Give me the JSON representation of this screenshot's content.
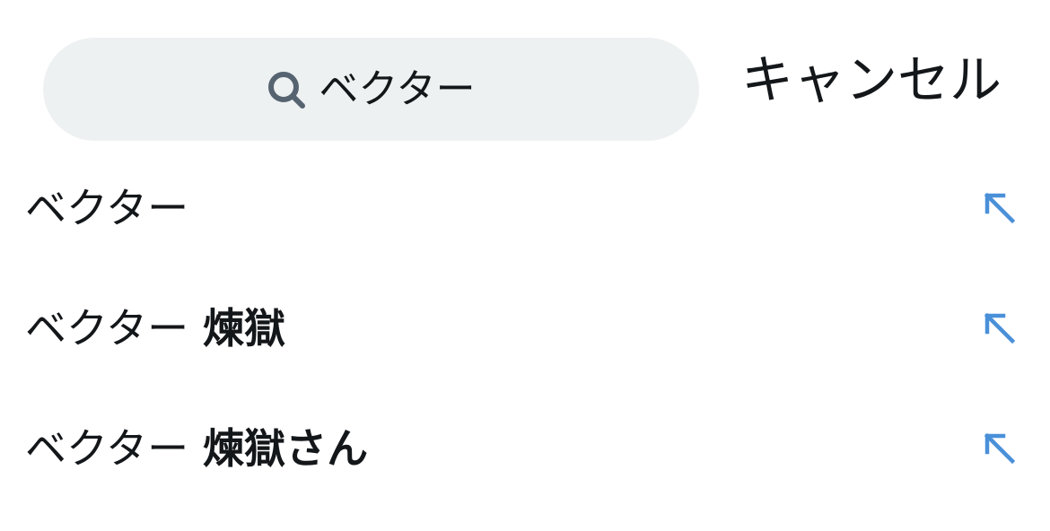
{
  "search": {
    "value": "ベクター",
    "icon": "search-icon",
    "cancel_label": "キャンセル"
  },
  "suggestions": [
    {
      "prefix": "ベクター",
      "suffix": "",
      "icon": "arrow-up-left-icon"
    },
    {
      "prefix": "ベクター",
      "suffix": " 煉獄",
      "icon": "arrow-up-left-icon"
    },
    {
      "prefix": "ベクター",
      "suffix": " 煉獄さん",
      "icon": "arrow-up-left-icon"
    }
  ],
  "colors": {
    "search_bg": "#eef1f2",
    "text": "#14171a",
    "icon_gray": "#566370",
    "accent_blue": "#4a90d9"
  }
}
